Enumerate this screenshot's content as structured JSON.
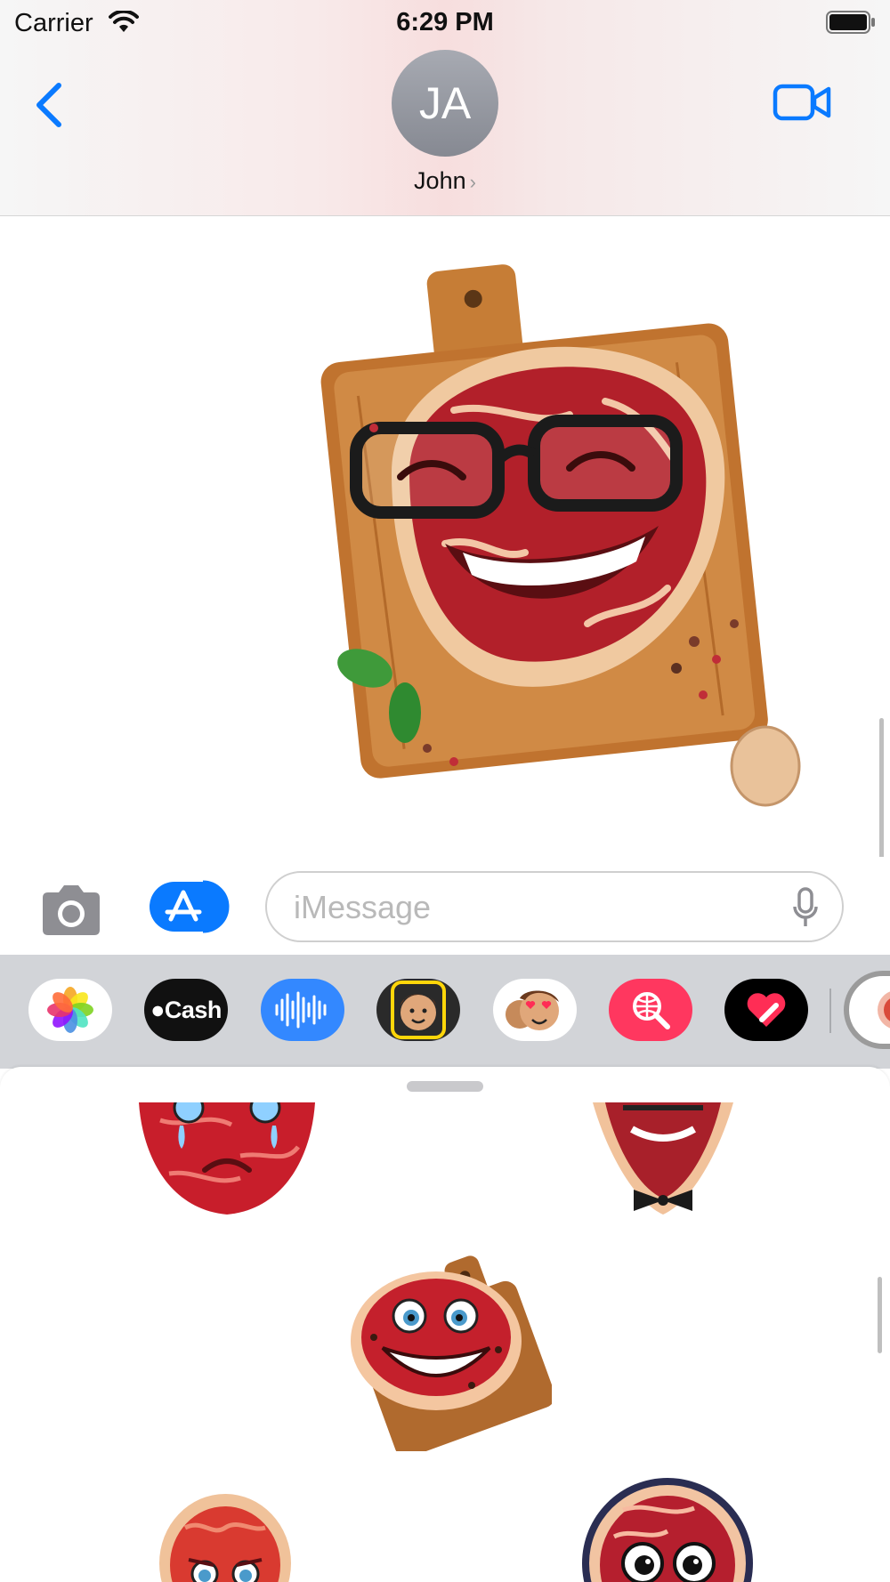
{
  "status_bar": {
    "carrier": "Carrier",
    "time": "6:29 PM"
  },
  "header": {
    "avatar_initials": "JA",
    "contact_name": "John",
    "contact_chevron": "›"
  },
  "conversation": {
    "message_sticker": "smiling-steak-with-glasses-on-cutting-board"
  },
  "input_bar": {
    "placeholder": "iMessage",
    "value": ""
  },
  "app_drawer": {
    "apps": [
      {
        "name": "Photos"
      },
      {
        "name": "Cash",
        "label": "Cash"
      },
      {
        "name": "Audio Message"
      },
      {
        "name": "Memoji Stickers"
      },
      {
        "name": "Memoji"
      },
      {
        "name": "Images Search"
      },
      {
        "name": "Digital Touch"
      },
      {
        "name": "Steak Stickers"
      }
    ]
  },
  "sticker_sheet": {
    "stickers": [
      "crying-steak-sticker",
      "steak-with-bowtie-sticker",
      "smiling-steak-on-board-sticker",
      "sad-steak-sticker",
      "surprised-steak-sticker"
    ]
  },
  "colors": {
    "ios_blue": "#0a7aff",
    "cash_black": "#111111",
    "search_pink": "#ff375f",
    "drawer_gray": "#d2d4d8"
  }
}
